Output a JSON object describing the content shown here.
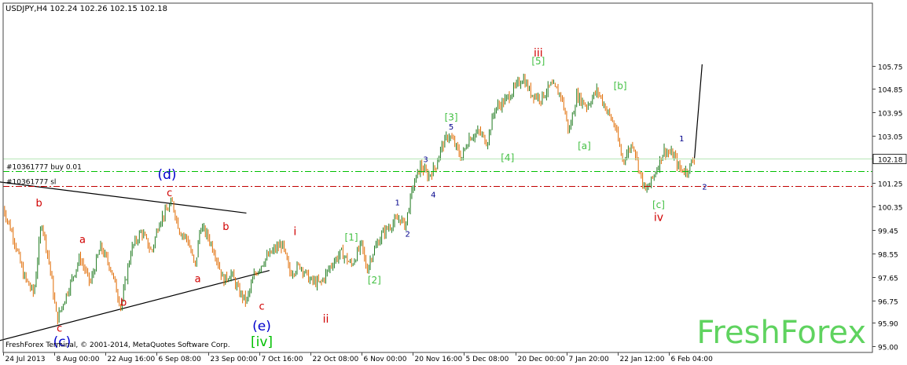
{
  "chart_data": {
    "type": "candlestick",
    "symbol_header": "USDJPY,H4  102.24 102.26 102.15 102.18",
    "y_ticks": [
      "105.75",
      "104.85",
      "103.95",
      "103.05",
      "102.18",
      "101.25",
      "100.35",
      "99.45",
      "98.55",
      "97.65",
      "96.75",
      "95.90",
      "95.00"
    ],
    "y_tick_values": [
      105.75,
      104.85,
      103.95,
      103.05,
      102.18,
      101.25,
      100.35,
      99.45,
      98.55,
      97.65,
      96.75,
      95.9,
      95.0
    ],
    "ylim": [
      95.0,
      105.75
    ],
    "x_ticks": [
      "24 Jul 2013",
      "8 Aug 00:00",
      "22 Aug 16:00",
      "6 Sep 08:00",
      "23 Sep 00:00",
      "7 Oct 16:00",
      "22 Oct 08:00",
      "6 Nov 00:00",
      "20 Nov 16:00",
      "5 Dec 08:00",
      "20 Dec 00:00",
      "7 Jan 20:00",
      "22 Jan 12:00",
      "6 Feb 04:00"
    ],
    "x_tick_index": [
      0,
      1,
      2,
      3,
      4,
      5,
      6,
      7,
      8,
      9,
      10,
      11,
      12,
      13
    ],
    "current_price": 102.18,
    "order_lines": [
      {
        "label": "#10361777 buy 0.01",
        "value": 101.7,
        "color": "#00c000",
        "style": "dash-dot"
      },
      {
        "label": "#10361777 sl",
        "value": 101.15,
        "color": "#c00000",
        "style": "dash-dot"
      }
    ],
    "price_path": [
      [
        0,
        100.3
      ],
      [
        0.2,
        99.2
      ],
      [
        0.4,
        97.7
      ],
      [
        0.6,
        97.0
      ],
      [
        0.75,
        99.8
      ],
      [
        0.9,
        98.2
      ],
      [
        1.05,
        96.0
      ],
      [
        1.2,
        96.8
      ],
      [
        1.5,
        98.4
      ],
      [
        1.7,
        97.4
      ],
      [
        1.9,
        98.8
      ],
      [
        2.1,
        98.0
      ],
      [
        2.3,
        96.5
      ],
      [
        2.5,
        98.7
      ],
      [
        2.7,
        99.4
      ],
      [
        2.9,
        98.6
      ],
      [
        3.05,
        99.8
      ],
      [
        3.2,
        100.2
      ],
      [
        3.3,
        100.5
      ],
      [
        3.45,
        99.4
      ],
      [
        3.6,
        99.1
      ],
      [
        3.75,
        98.0
      ],
      [
        3.85,
        99.6
      ],
      [
        4.0,
        99.2
      ],
      [
        4.15,
        98.5
      ],
      [
        4.3,
        97.5
      ],
      [
        4.45,
        97.8
      ],
      [
        4.6,
        97.1
      ],
      [
        4.75,
        96.7
      ],
      [
        4.9,
        97.7
      ],
      [
        5.1,
        98.3
      ],
      [
        5.3,
        98.7
      ],
      [
        5.45,
        98.9
      ],
      [
        5.6,
        97.8
      ],
      [
        5.8,
        98.1
      ],
      [
        6.0,
        97.5
      ],
      [
        6.2,
        97.4
      ],
      [
        6.4,
        98.1
      ],
      [
        6.6,
        98.6
      ],
      [
        6.8,
        98.1
      ],
      [
        7.0,
        98.9
      ],
      [
        7.1,
        97.9
      ],
      [
        7.2,
        98.5
      ],
      [
        7.4,
        99.3
      ],
      [
        7.6,
        99.7
      ],
      [
        7.75,
        99.9
      ],
      [
        7.85,
        99.6
      ],
      [
        8.0,
        101.1
      ],
      [
        8.15,
        101.9
      ],
      [
        8.3,
        101.5
      ],
      [
        8.45,
        101.9
      ],
      [
        8.55,
        102.6
      ],
      [
        8.7,
        103.1
      ],
      [
        8.8,
        102.8
      ],
      [
        8.95,
        102.2
      ],
      [
        9.1,
        103.0
      ],
      [
        9.3,
        103.2
      ],
      [
        9.45,
        102.8
      ],
      [
        9.6,
        104.1
      ],
      [
        9.8,
        104.4
      ],
      [
        10.0,
        104.9
      ],
      [
        10.15,
        105.3
      ],
      [
        10.3,
        104.7
      ],
      [
        10.5,
        104.5
      ],
      [
        10.7,
        105.0
      ],
      [
        10.9,
        104.6
      ],
      [
        11.05,
        103.2
      ],
      [
        11.2,
        104.6
      ],
      [
        11.4,
        104.2
      ],
      [
        11.6,
        104.8
      ],
      [
        11.8,
        104.0
      ],
      [
        11.95,
        103.4
      ],
      [
        12.1,
        102.1
      ],
      [
        12.3,
        102.8
      ],
      [
        12.45,
        101.5
      ],
      [
        12.55,
        100.9
      ],
      [
        12.7,
        101.5
      ],
      [
        12.9,
        102.5
      ],
      [
        13.1,
        102.3
      ],
      [
        13.2,
        101.8
      ],
      [
        13.35,
        101.7
      ],
      [
        13.5,
        102.2
      ]
    ],
    "projection": [
      [
        13.5,
        102.2
      ],
      [
        13.65,
        105.8
      ]
    ],
    "trendlines": [
      {
        "from": [
          -0.1,
          101.3
        ],
        "to": [
          4.75,
          100.1
        ]
      },
      {
        "from": [
          -0.1,
          95.2
        ],
        "to": [
          5.2,
          97.9
        ]
      }
    ],
    "wave_labels": [
      {
        "text": "iii",
        "x": 10.45,
        "y": 106.1,
        "color": "#d00000",
        "size": 14
      },
      {
        "text": "[5]",
        "x": 10.45,
        "y": 105.8,
        "color": "#44c044",
        "size": 12
      },
      {
        "text": "[b]",
        "x": 12.05,
        "y": 104.85,
        "color": "#44c044",
        "size": 12
      },
      {
        "text": "[3]",
        "x": 8.75,
        "y": 103.65,
        "color": "#44c044",
        "size": 12
      },
      {
        "text": "5",
        "x": 8.75,
        "y": 103.3,
        "color": "#00008b",
        "size": 10
      },
      {
        "text": "[a]",
        "x": 11.35,
        "y": 102.55,
        "color": "#44c044",
        "size": 12
      },
      {
        "text": "[4]",
        "x": 9.85,
        "y": 102.1,
        "color": "#44c044",
        "size": 12
      },
      {
        "text": "1",
        "x": 13.25,
        "y": 102.85,
        "color": "#00008b",
        "size": 10
      },
      {
        "text": "3",
        "x": 8.25,
        "y": 102.05,
        "color": "#00008b",
        "size": 10
      },
      {
        "text": "4",
        "x": 8.4,
        "y": 100.7,
        "color": "#00008b",
        "size": 10
      },
      {
        "text": "2",
        "x": 13.7,
        "y": 101.0,
        "color": "#00008b",
        "size": 10
      },
      {
        "text": "(d)",
        "x": 3.2,
        "y": 101.4,
        "color": "#0000cc",
        "size": 17
      },
      {
        "text": "c",
        "x": 3.25,
        "y": 100.75,
        "color": "#d00000",
        "size": 13
      },
      {
        "text": "b",
        "x": 0.7,
        "y": 100.35,
        "color": "#d00000",
        "size": 13
      },
      {
        "text": "[c]",
        "x": 12.8,
        "y": 100.3,
        "color": "#44c044",
        "size": 12
      },
      {
        "text": "iv",
        "x": 12.8,
        "y": 99.8,
        "color": "#d00000",
        "size": 14
      },
      {
        "text": "1",
        "x": 7.7,
        "y": 100.4,
        "color": "#00008b",
        "size": 10
      },
      {
        "text": "b",
        "x": 4.35,
        "y": 99.45,
        "color": "#d00000",
        "size": 13
      },
      {
        "text": "a",
        "x": 1.55,
        "y": 98.95,
        "color": "#d00000",
        "size": 13
      },
      {
        "text": "2",
        "x": 7.9,
        "y": 99.2,
        "color": "#00008b",
        "size": 10
      },
      {
        "text": "i",
        "x": 5.7,
        "y": 99.25,
        "color": "#d00000",
        "size": 14
      },
      {
        "text": "[1]",
        "x": 6.8,
        "y": 99.05,
        "color": "#44c044",
        "size": 12
      },
      {
        "text": "a",
        "x": 3.8,
        "y": 97.45,
        "color": "#d00000",
        "size": 13
      },
      {
        "text": "[2]",
        "x": 7.25,
        "y": 97.4,
        "color": "#44c044",
        "size": 12
      },
      {
        "text": "b",
        "x": 2.35,
        "y": 96.55,
        "color": "#d00000",
        "size": 13
      },
      {
        "text": "c",
        "x": 5.05,
        "y": 96.4,
        "color": "#d00000",
        "size": 13
      },
      {
        "text": "ii",
        "x": 6.3,
        "y": 95.9,
        "color": "#d00000",
        "size": 14
      },
      {
        "text": "c",
        "x": 1.1,
        "y": 95.55,
        "color": "#d00000",
        "size": 13
      },
      {
        "text": "(e)",
        "x": 5.05,
        "y": 95.6,
        "color": "#0000cc",
        "size": 17
      },
      {
        "text": "(c)",
        "x": 1.15,
        "y": 95.0,
        "color": "#0000cc",
        "size": 17
      },
      {
        "text": "[iv]",
        "x": 5.05,
        "y": 95.0,
        "color": "#00c000",
        "size": 17
      }
    ],
    "copyright": "FreshForex Terminal, © 2001-2014, MetaQuotes Software Corp.",
    "watermark": "FreshForex",
    "colors": {
      "candle_up": "#1f7a1f",
      "candle_down": "#e06a00",
      "current_line": "#b8e6b8",
      "projection": "#000000",
      "watermark": "#5fd35f",
      "axis": "#444444"
    }
  }
}
